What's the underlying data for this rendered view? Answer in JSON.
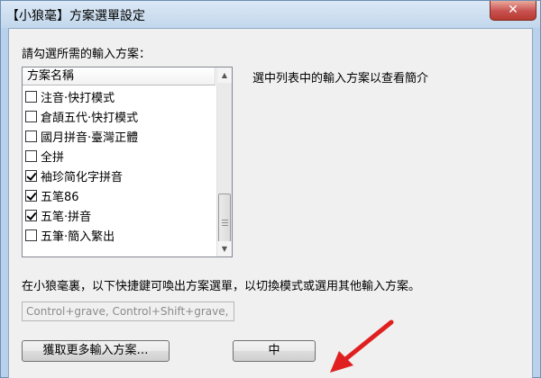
{
  "window": {
    "title": "【小狼毫】方案選單設定",
    "close_label": "✕"
  },
  "prompt": "請勾選所需的輸入方案：",
  "description": "選中列表中的輸入方案以查看簡介",
  "list": {
    "header": "方案名稱",
    "items": [
      {
        "label": "注音·快打模式",
        "checked": false
      },
      {
        "label": "倉頡五代·快打模式",
        "checked": false
      },
      {
        "label": "國月拼音·臺灣正體",
        "checked": false
      },
      {
        "label": "全拼",
        "checked": false
      },
      {
        "label": "袖珍简化字拼音",
        "checked": true
      },
      {
        "label": "五笔86",
        "checked": true
      },
      {
        "label": "五笔·拼音",
        "checked": true
      },
      {
        "label": "五筆·簡入繁出",
        "checked": false
      }
    ]
  },
  "hint": "在小狼毫裏，以下快捷鍵可喚出方案選單，以切換模式或選用其他輸入方案。",
  "hotkeys_value": "Control+grave, Control+Shift+grave,",
  "buttons": {
    "more_label": "獲取更多輸入方案…",
    "ok_label": "中"
  },
  "colors": {
    "arrow": "#e02020"
  }
}
